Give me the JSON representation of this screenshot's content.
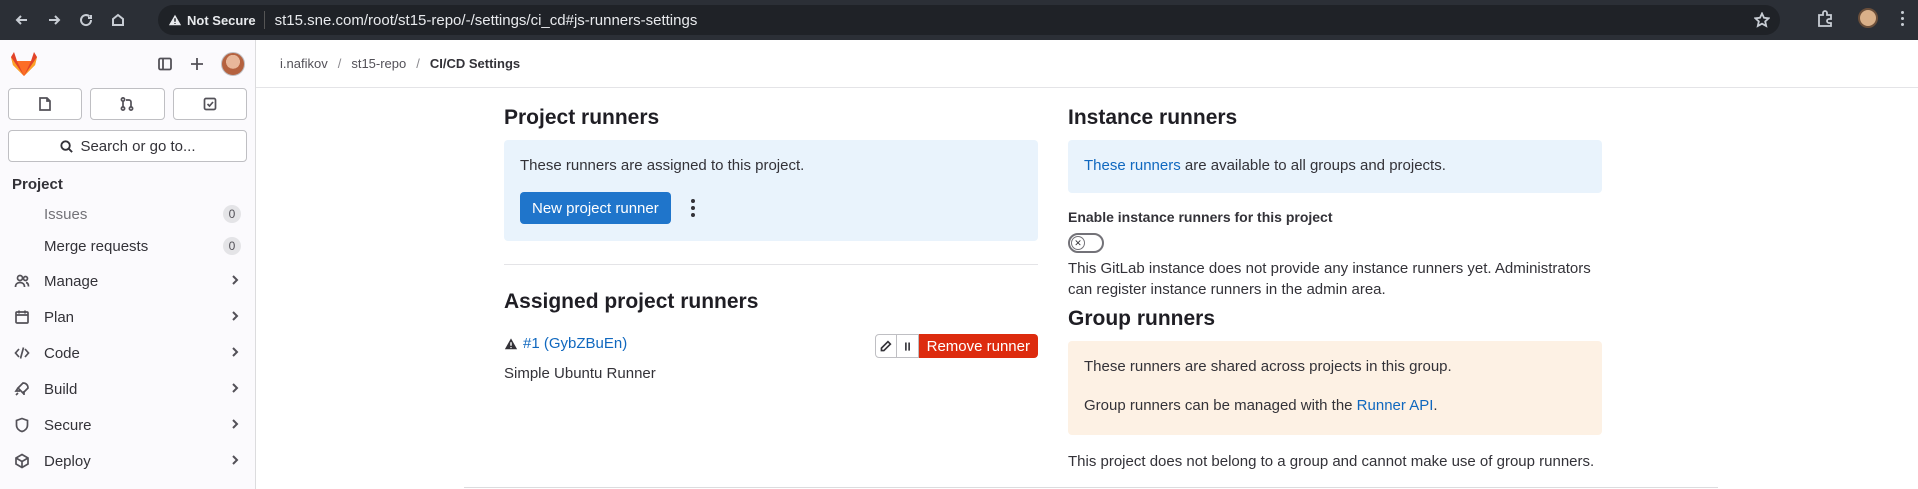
{
  "browser": {
    "security_label": "Not Secure",
    "url": "st15.sne.com/root/st15-repo/-/settings/ci_cd#js-runners-settings"
  },
  "sidebar": {
    "search_label": "Search or go to...",
    "section_title": "Project",
    "sub_items": [
      {
        "label": "Issues",
        "count": "0"
      },
      {
        "label": "Merge requests",
        "count": "0"
      }
    ],
    "items": [
      {
        "label": "Manage"
      },
      {
        "label": "Plan"
      },
      {
        "label": "Code"
      },
      {
        "label": "Build"
      },
      {
        "label": "Secure"
      },
      {
        "label": "Deploy"
      }
    ]
  },
  "breadcrumb": {
    "items": [
      "i.nafikov",
      "st15-repo",
      "CI/CD Settings"
    ],
    "separator": "/"
  },
  "project_runners": {
    "title": "Project runners",
    "description": "These runners are assigned to this project.",
    "new_button": "New project runner"
  },
  "assigned_runners": {
    "title": "Assigned project runners",
    "runner_link": "#1 (GybZBuEn)",
    "runner_description": "Simple Ubuntu Runner",
    "remove_button": "Remove runner"
  },
  "instance_runners": {
    "title": "Instance runners",
    "link_text": "These runners",
    "description_rest": " are available to all groups and projects.",
    "toggle_label": "Enable instance runners for this project",
    "toggle_on": false,
    "note": "This GitLab instance does not provide any instance runners yet. Administrators can register instance runners in the admin area."
  },
  "group_runners": {
    "title": "Group runners",
    "line1": "These runners are shared across projects in this group.",
    "line2_prefix": "Group runners can be managed with the ",
    "line2_link": "Runner API",
    "line2_suffix": ".",
    "note": "This project does not belong to a group and cannot make use of group runners."
  },
  "colors": {
    "primary": "#1f75cb",
    "danger": "#dd2b0e",
    "info_bg": "#e9f3fc",
    "warning_bg": "#fdf1e4"
  }
}
